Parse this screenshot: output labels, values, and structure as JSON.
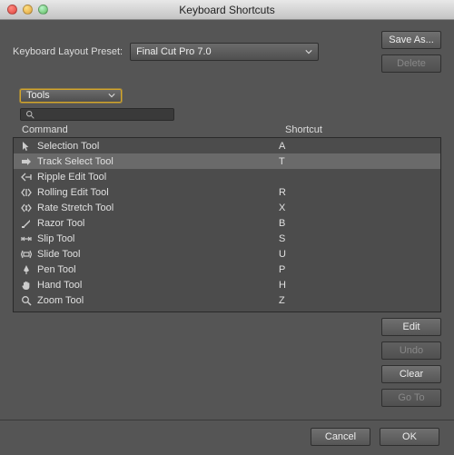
{
  "window": {
    "title": "Keyboard Shortcuts"
  },
  "preset": {
    "label": "Keyboard Layout Preset:",
    "value": "Final Cut Pro 7.0"
  },
  "topButtons": {
    "saveAs": "Save As...",
    "delete": "Delete"
  },
  "filter": {
    "value": "Tools"
  },
  "search": {
    "placeholder": ""
  },
  "columns": {
    "command": "Command",
    "shortcut": "Shortcut"
  },
  "commands": [
    {
      "name": "Selection Tool",
      "shortcut": "A",
      "icon": "cursor",
      "selected": false
    },
    {
      "name": "Track Select Tool",
      "shortcut": "T",
      "icon": "track-select",
      "selected": true
    },
    {
      "name": "Ripple Edit Tool",
      "shortcut": "",
      "icon": "ripple",
      "selected": false
    },
    {
      "name": "Rolling Edit Tool",
      "shortcut": "R",
      "icon": "rolling",
      "selected": false
    },
    {
      "name": "Rate Stretch Tool",
      "shortcut": "X",
      "icon": "rate",
      "selected": false
    },
    {
      "name": "Razor Tool",
      "shortcut": "B",
      "icon": "razor",
      "selected": false
    },
    {
      "name": "Slip Tool",
      "shortcut": "S",
      "icon": "slip",
      "selected": false
    },
    {
      "name": "Slide Tool",
      "shortcut": "U",
      "icon": "slide",
      "selected": false
    },
    {
      "name": "Pen Tool",
      "shortcut": "P",
      "icon": "pen",
      "selected": false
    },
    {
      "name": "Hand Tool",
      "shortcut": "H",
      "icon": "hand",
      "selected": false
    },
    {
      "name": "Zoom Tool",
      "shortcut": "Z",
      "icon": "zoom",
      "selected": false
    }
  ],
  "listButtons": {
    "edit": "Edit",
    "undo": "Undo",
    "clear": "Clear",
    "goTo": "Go To"
  },
  "dialogButtons": {
    "cancel": "Cancel",
    "ok": "OK"
  }
}
